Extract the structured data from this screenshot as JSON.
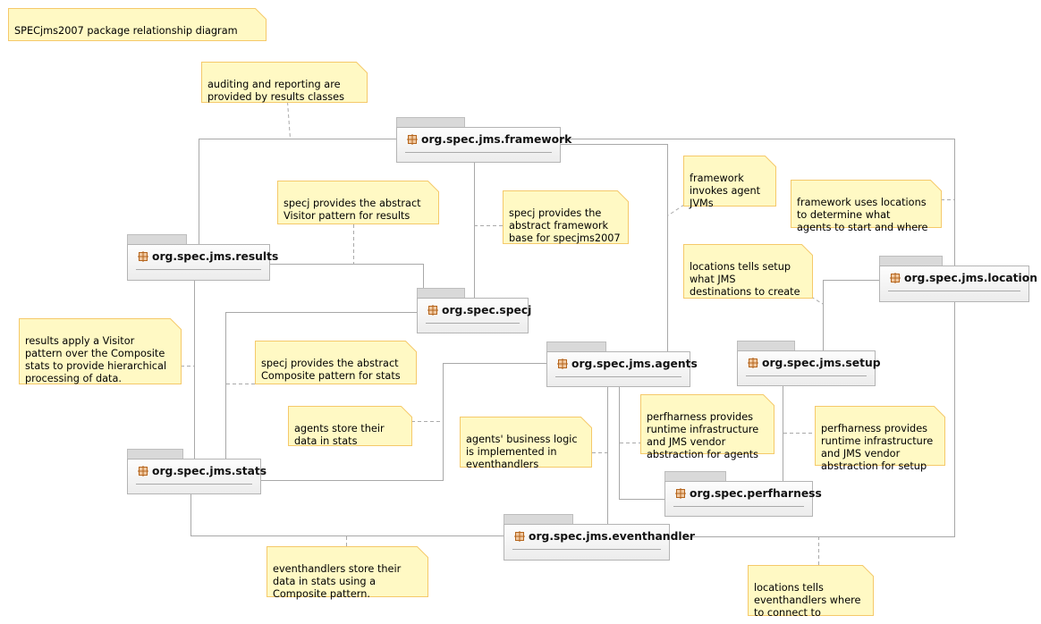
{
  "diagram": {
    "title_note": "SPECjms2007 package relationship diagram",
    "colors": {
      "note_fill": "#fff9c4",
      "note_border": "#f5c96a",
      "package_border": "#b4b4b4",
      "package_tab": "#d9d9d9",
      "connector": "#a8a8a8",
      "package_icon": "#b5651d"
    },
    "packages": {
      "framework": "org.spec.jms.framework",
      "results": "org.spec.jms.results",
      "specj": "org.spec.specj",
      "location": "org.spec.jms.location",
      "agents": "org.spec.jms.agents",
      "setup": "org.spec.jms.setup",
      "stats": "org.spec.jms.stats",
      "perfharness": "org.spec.perfharness",
      "eventhandler": "org.spec.jms.eventhandler"
    },
    "notes": {
      "auditing": "auditing and reporting are\nprovided by results classes",
      "visitor_results": "specj provides the abstract\nVisitor pattern for results",
      "framework_base": "specj provides the\nabstract framework\nbase for specjms2007",
      "invokes_agents": "framework\ninvokes agent\nJVMs",
      "uses_locations": "framework uses locations\nto determine what\nagents to start and where",
      "locations_setup": "locations tells setup\nwhat JMS\ndestinations to create",
      "results_visitor": "results apply a Visitor\npattern over the Composite\nstats to provide hierarchical\nprocessing of data.",
      "composite_stats": "specj provides the abstract\nComposite pattern for stats",
      "agents_store": "agents store their\ndata in stats",
      "business_logic": "agents' business logic\nis implemented in\neventhandlers",
      "perf_agents": "perfharness provides\nruntime infrastructure\nand JMS vendor\nabstraction for agents",
      "perf_setup": "perfharness provides\nruntime infrastructure\nand JMS vendor\nabstraction for setup",
      "eventhandlers_store": "eventhandlers store their\ndata in stats using a\nComposite pattern.",
      "locations_eventhandlers": "locations tells\neventhandlers where\nto connect to"
    }
  }
}
